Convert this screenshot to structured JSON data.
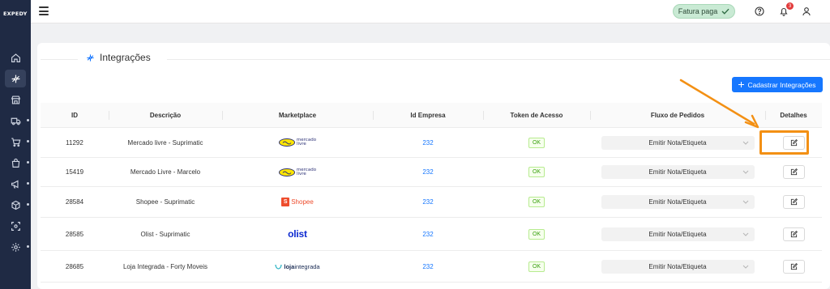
{
  "app": {
    "logo_text": "EXPEDY"
  },
  "sidebar": {
    "items": [
      {
        "icon": "home-icon",
        "active": false,
        "has_dot": false
      },
      {
        "icon": "integrations-icon",
        "active": true,
        "has_dot": false
      },
      {
        "icon": "store-icon",
        "active": false,
        "has_dot": false
      },
      {
        "icon": "truck-icon",
        "active": false,
        "has_dot": true
      },
      {
        "icon": "cart-icon",
        "active": false,
        "has_dot": true
      },
      {
        "icon": "bag-icon",
        "active": false,
        "has_dot": true
      },
      {
        "icon": "megaphone-icon",
        "active": false,
        "has_dot": true
      },
      {
        "icon": "box-icon",
        "active": false,
        "has_dot": true
      },
      {
        "icon": "scan-icon",
        "active": false,
        "has_dot": false
      },
      {
        "icon": "gear-icon",
        "active": false,
        "has_dot": true
      }
    ]
  },
  "topbar": {
    "status_badge": "Fatura paga",
    "notification_count": "3"
  },
  "page": {
    "title": "Integrações",
    "add_button": "Cadastrar Integrações"
  },
  "table": {
    "headers": {
      "id": "ID",
      "description": "Descrição",
      "marketplace": "Marketplace",
      "company_id": "Id Empresa",
      "token": "Token de Acesso",
      "flow": "Fluxo de Pedidos",
      "details": "Detalhes"
    },
    "rows": [
      {
        "id": "11292",
        "description": "Mercado livre - Suprimatic",
        "marketplace": "mercadolivre",
        "company_id": "232",
        "token": "OK",
        "flow": "Emitir Nota/Etiqueta"
      },
      {
        "id": "15419",
        "description": "Mercado Livre - Marcelo",
        "marketplace": "mercadolivre",
        "company_id": "232",
        "token": "OK",
        "flow": "Emitir Nota/Etiqueta"
      },
      {
        "id": "28584",
        "description": "Shopee - Suprimatic",
        "marketplace": "shopee",
        "company_id": "232",
        "token": "OK",
        "flow": "Emitir Nota/Etiqueta"
      },
      {
        "id": "28585",
        "description": "Olist - Suprimatic",
        "marketplace": "olist",
        "company_id": "232",
        "token": "OK",
        "flow": "Emitir Nota/Etiqueta"
      },
      {
        "id": "28685",
        "description": "Loja Integrada - Forty Moveis",
        "marketplace": "lojaintegrada",
        "company_id": "232",
        "token": "OK",
        "flow": "Emitir Nota/Etiqueta"
      }
    ]
  },
  "logos": {
    "mercadolivre_line1": "mercado",
    "mercadolivre_line2": "livre",
    "shopee": "Shopee",
    "shopee_bag": "S",
    "olist": "olist",
    "loja_bold": "loja",
    "loja_rest": "integrada"
  },
  "colors": {
    "sidebar_bg": "#1f2a44",
    "accent": "#1677ff",
    "annotation": "#f39014",
    "ok_green": "#389e0d"
  }
}
